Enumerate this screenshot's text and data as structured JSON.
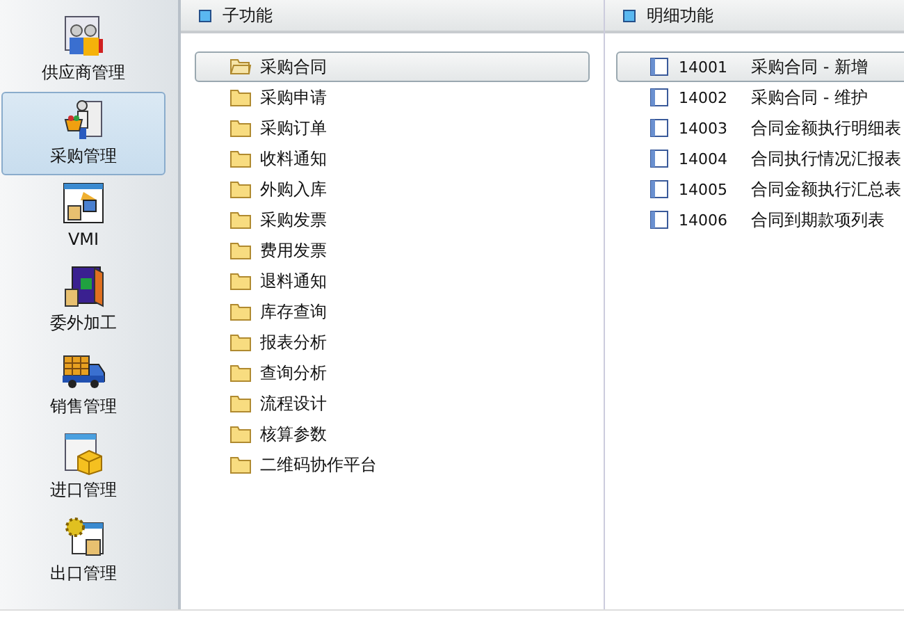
{
  "sidebar": {
    "items": [
      {
        "label": "供应商管理",
        "selected": false
      },
      {
        "label": "采购管理",
        "selected": true
      },
      {
        "label": "VMI",
        "selected": false
      },
      {
        "label": "委外加工",
        "selected": false
      },
      {
        "label": "销售管理",
        "selected": false
      },
      {
        "label": "进口管理",
        "selected": false
      },
      {
        "label": "出口管理",
        "selected": false
      }
    ]
  },
  "sub_functions": {
    "title": "子功能",
    "items": [
      {
        "label": "采购合同",
        "selected": true
      },
      {
        "label": "采购申请",
        "selected": false
      },
      {
        "label": "采购订单",
        "selected": false
      },
      {
        "label": "收料通知",
        "selected": false
      },
      {
        "label": "外购入库",
        "selected": false
      },
      {
        "label": "采购发票",
        "selected": false
      },
      {
        "label": "费用发票",
        "selected": false
      },
      {
        "label": "退料通知",
        "selected": false
      },
      {
        "label": "库存查询",
        "selected": false
      },
      {
        "label": "报表分析",
        "selected": false
      },
      {
        "label": "查询分析",
        "selected": false
      },
      {
        "label": "流程设计",
        "selected": false
      },
      {
        "label": "核算参数",
        "selected": false
      },
      {
        "label": "二维码协作平台",
        "selected": false
      }
    ]
  },
  "detail_functions": {
    "title": "明细功能",
    "items": [
      {
        "code": "14001",
        "label": "采购合同 - 新增",
        "selected": true
      },
      {
        "code": "14002",
        "label": "采购合同 - 维护",
        "selected": false
      },
      {
        "code": "14003",
        "label": "合同金额执行明细表",
        "selected": false
      },
      {
        "code": "14004",
        "label": "合同执行情况汇报表",
        "selected": false
      },
      {
        "code": "14005",
        "label": "合同金额执行汇总表",
        "selected": false
      },
      {
        "code": "14006",
        "label": "合同到期款项列表",
        "selected": false
      }
    ]
  }
}
